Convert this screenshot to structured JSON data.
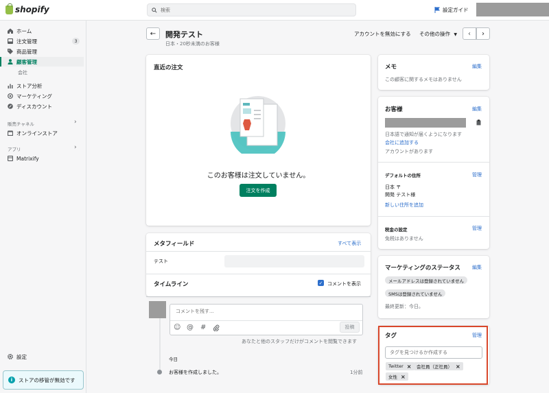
{
  "topbar": {
    "logo_text": "shopify",
    "search_placeholder": "検索",
    "guide_label": "設定ガイド"
  },
  "sidebar": {
    "items": [
      {
        "label": "ホーム",
        "icon": "home-icon"
      },
      {
        "label": "注文管理",
        "icon": "orders-icon",
        "badge": "3"
      },
      {
        "label": "商品管理",
        "icon": "tag-icon"
      },
      {
        "label": "顧客管理",
        "icon": "person-icon",
        "active": true
      },
      {
        "label": "ストア分析",
        "icon": "analytics-icon"
      },
      {
        "label": "マーケティング",
        "icon": "marketing-icon"
      },
      {
        "label": "ディスカウント",
        "icon": "discount-icon"
      }
    ],
    "sub_item": "会社",
    "sales_channels_label": "販売チャネル",
    "online_store_label": "オンラインストア",
    "apps_label": "アプリ",
    "app_item": "Matrixify",
    "settings_label": "設定",
    "notice_text": "ストアの移管が無効です"
  },
  "header": {
    "title": "開発テスト",
    "subtitle": "日本・20秒未満のお客様",
    "disable_account": "アカウントを無効にする",
    "other_actions": "その他の操作"
  },
  "recent_orders": {
    "title": "直近の注文",
    "empty_text": "このお客様は注文していません。",
    "create_button": "注文を作成"
  },
  "metafields": {
    "title": "メタフィールド",
    "show_all": "すべて表示",
    "field_label": "テスト"
  },
  "timeline": {
    "title": "タイムライン",
    "show_comments": "コメントを表示",
    "comment_placeholder": "コメントを残す...",
    "post_button": "投稿",
    "visibility_note": "あなたと他のスタッフだけがコメントを閲覧できます",
    "date_label": "今日",
    "event_text": "お客様を作成しました。",
    "event_time": "1分前"
  },
  "memo": {
    "title": "メモ",
    "edit": "編集",
    "empty": "この顧客に関するメモはありません"
  },
  "customer": {
    "title": "お客様",
    "edit": "編集",
    "notify_lang": "日本語で通知が届くようになります",
    "add_company": "会社に追加する",
    "has_account": "アカウントがあります",
    "address_title": "デフォルトの住所",
    "manage": "管理",
    "address_line1": "日本 〒",
    "address_line2": "開発 テスト様",
    "add_address": "新しい住所を追加",
    "tax_title": "税金の設定",
    "tax_manage": "管理",
    "tax_value": "免税はありません"
  },
  "marketing": {
    "title": "マーケティングのステータス",
    "edit": "編集",
    "email_status": "メールアドレスは登録されていません",
    "sms_status": "SMSは登録されていません",
    "last_updated": "最終更新：今日。"
  },
  "tags": {
    "title": "タグ",
    "manage": "管理",
    "input_placeholder": "タグを見つけるか作成する",
    "items": [
      "Twitter",
      "会社員（正社員）",
      "女性"
    ]
  },
  "colors": {
    "accent": "#008060",
    "link": "#2c6ecb",
    "highlight": "#d9472b"
  }
}
